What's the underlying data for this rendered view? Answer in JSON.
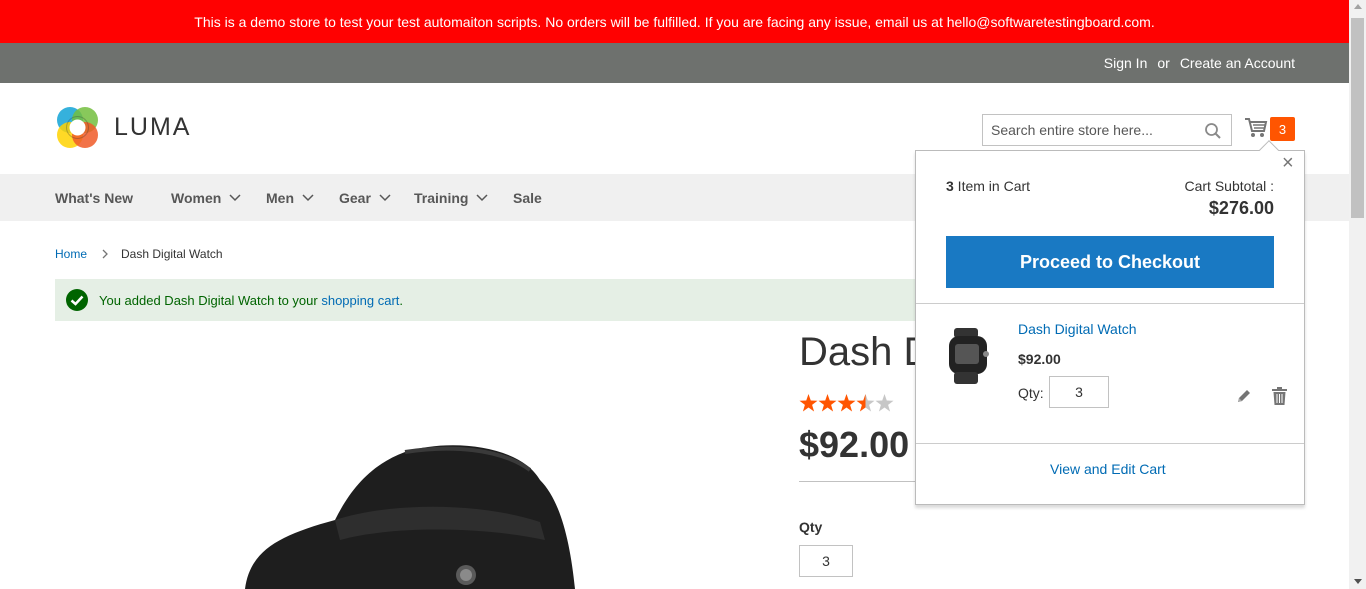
{
  "banner": {
    "text": "This is a demo store to test your test automaiton scripts. No orders will be fulfilled. If you are facing any issue, email us at hello@softwaretestingboard.com."
  },
  "header": {
    "sign_in": "Sign In",
    "or": "or",
    "create_account": "Create an Account"
  },
  "logo": {
    "text": "LUMA"
  },
  "search": {
    "placeholder": "Search entire store here...",
    "icon": "search-icon"
  },
  "cart": {
    "count": "3",
    "icon": "cart-icon",
    "badge_color": "#ff5501"
  },
  "nav": {
    "items": [
      {
        "label": "What's New"
      },
      {
        "label": "Women"
      },
      {
        "label": "Men"
      },
      {
        "label": "Gear"
      },
      {
        "label": "Training"
      },
      {
        "label": "Sale"
      }
    ]
  },
  "breadcrumb": {
    "home": "Home",
    "current": "Dash Digital Watch"
  },
  "message": {
    "prefix": "You added Dash Digital Watch to your ",
    "link": "shopping cart",
    "suffix": "."
  },
  "product": {
    "title": "Dash Digital Watch",
    "rating": 3.5,
    "rating_max": 5,
    "price": "$92.00",
    "qty_label": "Qty",
    "qty_value": "3"
  },
  "minicart": {
    "count": "3",
    "count_suffix": " Item in Cart",
    "subtotal_label": "Cart Subtotal :",
    "subtotal_value": "$276.00",
    "checkout_label": "Proceed to Checkout",
    "item": {
      "name": "Dash Digital Watch",
      "price": "$92.00",
      "qty_label": "Qty:",
      "qty_value": "3"
    },
    "view_edit_label": "View and Edit Cart",
    "close_glyph": "×"
  },
  "colors": {
    "banner": "#ff0101",
    "header_bar": "#6e716e",
    "primary_button": "#1979c3",
    "link": "#006bb4",
    "star": "#ff5501",
    "success": "#006400"
  }
}
